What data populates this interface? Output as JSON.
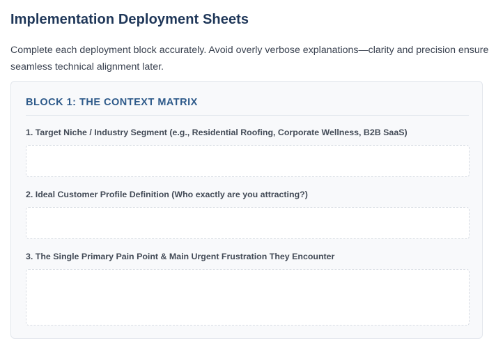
{
  "page": {
    "title": "Implementation Deployment Sheets",
    "intro": "Complete each deployment block accurately. Avoid overly verbose explanations—clarity and precision ensure seamless technical alignment later."
  },
  "block": {
    "title": "BLOCK 1: THE CONTEXT MATRIX",
    "fields": [
      {
        "label": "1. Target Niche / Industry Segment (e.g., Residential Roofing, Corporate Wellness, B2B SaaS)",
        "value": ""
      },
      {
        "label": "2. Ideal Customer Profile Definition (Who exactly are you attracting?)",
        "value": ""
      },
      {
        "label": "3. The Single Primary Pain Point & Main Urgent Frustration They Encounter",
        "value": ""
      }
    ]
  },
  "colors": {
    "title": "#1e3658",
    "block_title": "#2e5a8a",
    "card_background": "#f8f9fb",
    "input_border": "#d7dce3"
  }
}
